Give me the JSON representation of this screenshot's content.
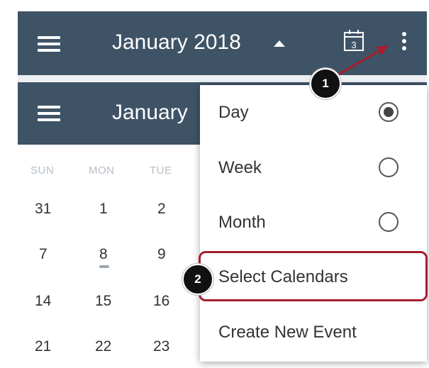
{
  "top_bar": {
    "title": "January 2018",
    "calendar_icon_day": "3"
  },
  "second_bar": {
    "title": "January"
  },
  "calendar": {
    "weekdays": [
      "SUN",
      "MON",
      "TUE"
    ],
    "days": [
      [
        "31",
        "1",
        "2"
      ],
      [
        "7",
        "8",
        "9"
      ],
      [
        "14",
        "15",
        "16"
      ],
      [
        "21",
        "22",
        "23"
      ]
    ]
  },
  "menu": {
    "items": [
      {
        "label": "Day",
        "selected": true
      },
      {
        "label": "Week",
        "selected": false
      },
      {
        "label": "Month",
        "selected": false
      },
      {
        "label": "Select Calendars"
      },
      {
        "label": "Create New Event"
      }
    ]
  },
  "callouts": [
    "1",
    "2"
  ],
  "colors": {
    "app_bar": "#3f5366",
    "highlight": "#a51e2e",
    "arrow": "#a51e2e"
  }
}
